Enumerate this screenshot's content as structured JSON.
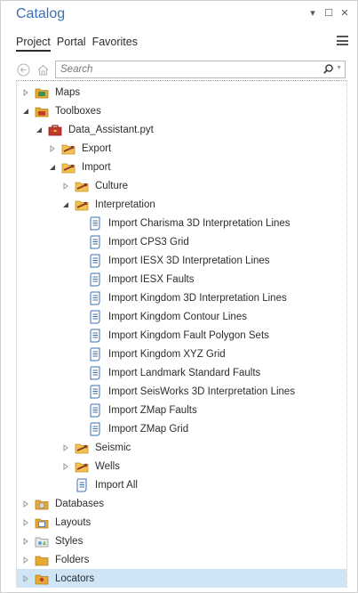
{
  "header": {
    "title": "Catalog"
  },
  "tabs": [
    {
      "label": "Project",
      "active": true
    },
    {
      "label": "Portal",
      "active": false
    },
    {
      "label": "Favorites",
      "active": false
    }
  ],
  "search": {
    "placeholder": "Search"
  },
  "colors": {
    "accent": "#3b6fb0",
    "selected": "#cfe4f5",
    "folder": "#e5a935",
    "toolbox": "#c0392b",
    "script": "#3b6fb0"
  },
  "tree": [
    {
      "label": "Maps",
      "depth": 0,
      "state": "collapsed",
      "icon": "maps-folder-icon"
    },
    {
      "label": "Toolboxes",
      "depth": 0,
      "state": "expanded",
      "icon": "toolboxes-folder-icon"
    },
    {
      "label": "Data_Assistant.pyt",
      "depth": 1,
      "state": "expanded",
      "icon": "python-toolbox-icon"
    },
    {
      "label": "Export",
      "depth": 2,
      "state": "collapsed",
      "icon": "toolset-icon"
    },
    {
      "label": "Import",
      "depth": 2,
      "state": "expanded",
      "icon": "toolset-icon"
    },
    {
      "label": "Culture",
      "depth": 3,
      "state": "collapsed",
      "icon": "toolset-icon"
    },
    {
      "label": "Interpretation",
      "depth": 3,
      "state": "expanded",
      "icon": "toolset-icon"
    },
    {
      "label": "Import Charisma 3D Interpretation Lines",
      "depth": 4,
      "state": "leaf",
      "icon": "script-tool-icon"
    },
    {
      "label": "Import CPS3 Grid",
      "depth": 4,
      "state": "leaf",
      "icon": "script-tool-icon"
    },
    {
      "label": "Import IESX 3D Interpretation Lines",
      "depth": 4,
      "state": "leaf",
      "icon": "script-tool-icon"
    },
    {
      "label": "Import IESX Faults",
      "depth": 4,
      "state": "leaf",
      "icon": "script-tool-icon"
    },
    {
      "label": "Import Kingdom 3D Interpretation Lines",
      "depth": 4,
      "state": "leaf",
      "icon": "script-tool-icon"
    },
    {
      "label": "Import Kingdom Contour Lines",
      "depth": 4,
      "state": "leaf",
      "icon": "script-tool-icon"
    },
    {
      "label": "Import Kingdom Fault Polygon Sets",
      "depth": 4,
      "state": "leaf",
      "icon": "script-tool-icon"
    },
    {
      "label": "Import Kingdom XYZ Grid",
      "depth": 4,
      "state": "leaf",
      "icon": "script-tool-icon"
    },
    {
      "label": "Import Landmark Standard Faults",
      "depth": 4,
      "state": "leaf",
      "icon": "script-tool-icon"
    },
    {
      "label": "Import SeisWorks 3D Interpretation Lines",
      "depth": 4,
      "state": "leaf",
      "icon": "script-tool-icon"
    },
    {
      "label": "Import ZMap Faults",
      "depth": 4,
      "state": "leaf",
      "icon": "script-tool-icon"
    },
    {
      "label": "Import ZMap Grid",
      "depth": 4,
      "state": "leaf",
      "icon": "script-tool-icon"
    },
    {
      "label": "Seismic",
      "depth": 3,
      "state": "collapsed",
      "icon": "toolset-icon"
    },
    {
      "label": "Wells",
      "depth": 3,
      "state": "collapsed",
      "icon": "toolset-icon"
    },
    {
      "label": "Import All",
      "depth": 3,
      "state": "leaf",
      "icon": "script-tool-icon"
    },
    {
      "label": "Databases",
      "depth": 0,
      "state": "collapsed",
      "icon": "databases-folder-icon"
    },
    {
      "label": "Layouts",
      "depth": 0,
      "state": "collapsed",
      "icon": "layouts-folder-icon"
    },
    {
      "label": "Styles",
      "depth": 0,
      "state": "collapsed",
      "icon": "styles-folder-icon"
    },
    {
      "label": "Folders",
      "depth": 0,
      "state": "collapsed",
      "icon": "folders-folder-icon"
    },
    {
      "label": "Locators",
      "depth": 0,
      "state": "collapsed",
      "icon": "locators-folder-icon",
      "selected": true
    }
  ]
}
